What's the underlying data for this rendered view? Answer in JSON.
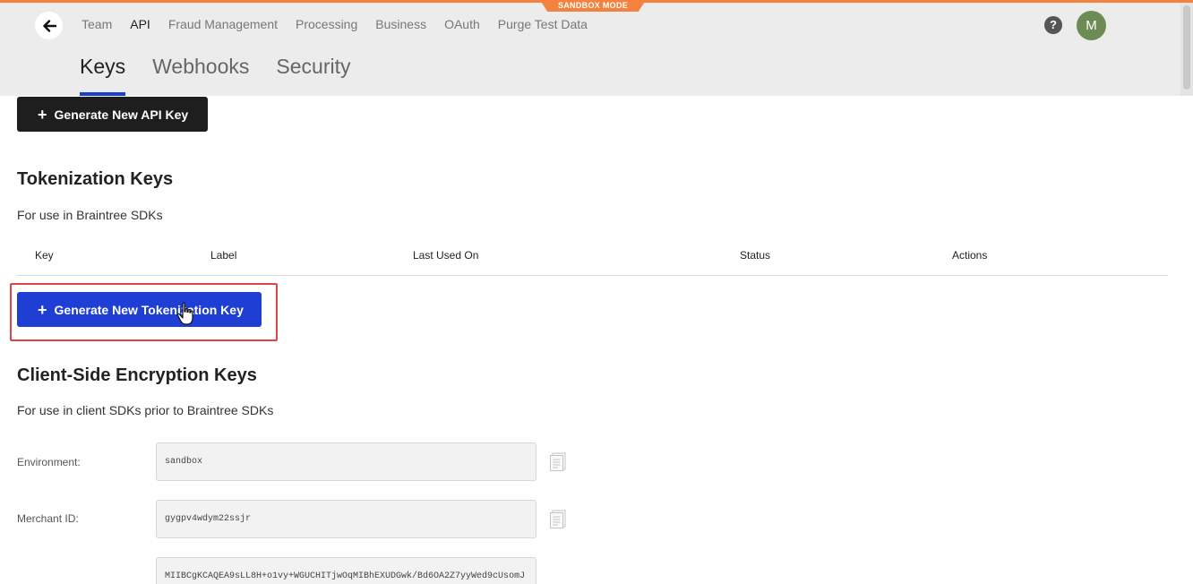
{
  "banner": {
    "mode_label": "SANDBOX MODE",
    "accent_color": "#f5813f"
  },
  "header": {
    "back_icon": "arrow-left-icon",
    "nav": [
      {
        "label": "Team",
        "active": false
      },
      {
        "label": "API",
        "active": true
      },
      {
        "label": "Fraud Management",
        "active": false
      },
      {
        "label": "Processing",
        "active": false
      },
      {
        "label": "Business",
        "active": false
      },
      {
        "label": "OAuth",
        "active": false
      },
      {
        "label": "Purge Test Data",
        "active": false
      }
    ],
    "help_label": "?",
    "avatar_initial": "M",
    "avatar_color": "#6d8b55"
  },
  "subtabs": [
    {
      "label": "Keys",
      "active": true
    },
    {
      "label": "Webhooks",
      "active": false
    },
    {
      "label": "Security",
      "active": false
    }
  ],
  "api_keys": {
    "generate_button": "Generate New API Key"
  },
  "tokenization": {
    "title": "Tokenization Keys",
    "subtitle": "For use in Braintree SDKs",
    "columns": [
      "Key",
      "Label",
      "Last Used On",
      "Status",
      "Actions"
    ],
    "generate_button": "Generate New Tokenization Key",
    "button_color": "#1f3fd4"
  },
  "cse": {
    "title": "Client-Side Encryption Keys",
    "subtitle": "For use in client SDKs prior to Braintree SDKs",
    "fields": [
      {
        "label": "Environment:",
        "value": "sandbox"
      },
      {
        "label": "Merchant ID:",
        "value": "gygpv4wdym22ssjr"
      },
      {
        "label": "",
        "value": "MIIBCgKCAQEA9sLL8H+o1vy+WGUCHITjwOqMIBhEXUDGwk/Bd6OA2Z7yyWed9cUsomJ"
      }
    ]
  }
}
